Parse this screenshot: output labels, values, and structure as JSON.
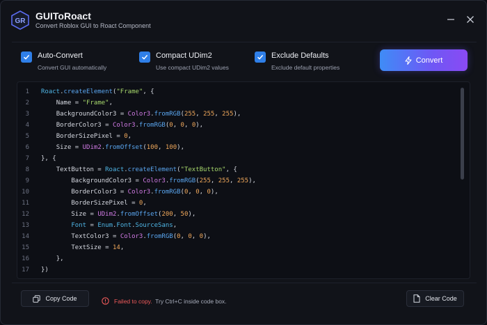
{
  "app": {
    "title": "GUIToRoact",
    "subtitle": "Convert Roblox GUI to Roact Component",
    "logo_text": "GR"
  },
  "window_controls": {
    "minimize_icon": "minus-icon",
    "close_icon": "close-icon"
  },
  "options": [
    {
      "label": "Auto-Convert",
      "description": "Convert GUI automatically",
      "checked": true
    },
    {
      "label": "Compact UDim2",
      "description": "Use compact UDim2 values",
      "checked": true
    },
    {
      "label": "Exclude Defaults",
      "description": "Exclude default properties",
      "checked": true
    }
  ],
  "convert_button": {
    "label": "Convert",
    "icon": "lightning-icon"
  },
  "code": {
    "lines": [
      "Roact.createElement(\"Frame\", {",
      "    Name = \"Frame\",",
      "    BackgroundColor3 = Color3.fromRGB(255, 255, 255),",
      "    BorderColor3 = Color3.fromRGB(0, 0, 0),",
      "    BorderSizePixel = 0,",
      "    Size = UDim2.fromOffset(100, 100),",
      "}, {",
      "    TextButton = Roact.createElement(\"TextButton\", {",
      "        BackgroundColor3 = Color3.fromRGB(255, 255, 255),",
      "        BorderColor3 = Color3.fromRGB(0, 0, 0),",
      "        BorderSizePixel = 0,",
      "        Size = UDim2.fromOffset(200, 50),",
      "        Font = Enum.Font.SourceSans,",
      "        TextColor3 = Color3.fromRGB(0, 0, 0),",
      "        TextSize = 14,",
      "    },",
      "})"
    ]
  },
  "footer": {
    "copy_button": "Copy Code",
    "status_error": "Failed to copy.",
    "status_hint": "Try Ctrl+C inside code box.",
    "clear_button": "Clear Code"
  },
  "colors": {
    "accent": "#2f7fe8",
    "gradient_start": "#3f8cf6",
    "gradient_end": "#8a4af3",
    "error": "#ef5a5a"
  }
}
